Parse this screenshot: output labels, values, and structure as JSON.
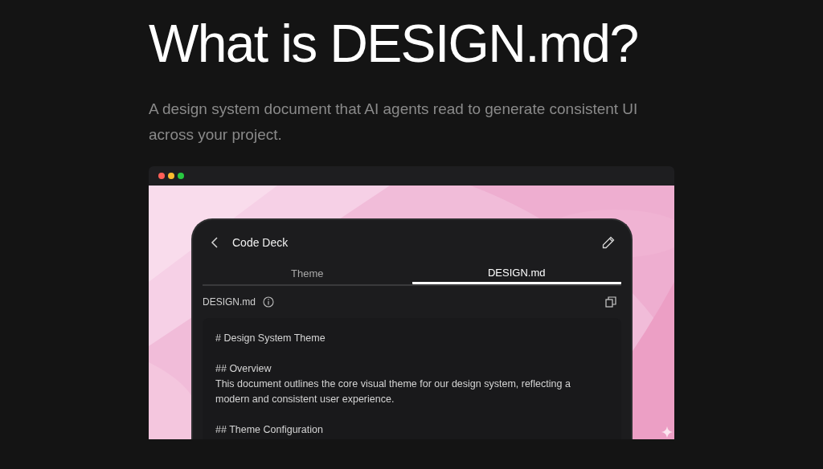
{
  "heading": "What is DESIGN.md?",
  "subtitle": "A design system document that AI agents read to generate consistent UI across your project.",
  "app": {
    "title": "Code Deck",
    "tabs": [
      {
        "label": "Theme",
        "selected": false
      },
      {
        "label": "DESIGN.md",
        "selected": true
      }
    ],
    "file_label": "DESIGN.md",
    "document": [
      {
        "lines": [
          "# Design System Theme"
        ]
      },
      {
        "lines": [
          "## Overview",
          "This document outlines the core visual theme for our design system, reflecting a modern and consistent user experience."
        ]
      },
      {
        "lines": [
          "## Theme Configuration"
        ]
      }
    ]
  }
}
